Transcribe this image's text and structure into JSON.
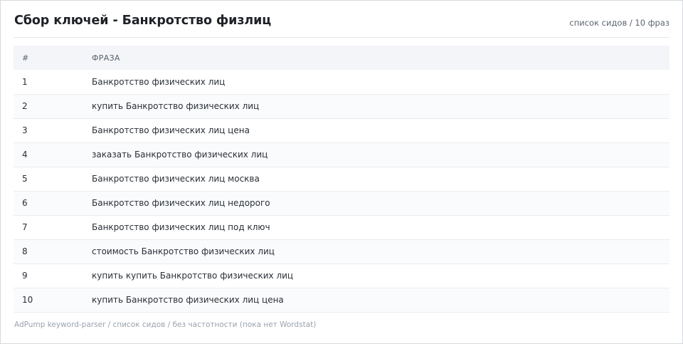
{
  "header": {
    "title": "Сбор ключей - Банкротство физлиц",
    "subtitle": "список сидов / 10 фраз"
  },
  "table": {
    "columns": [
      "#",
      "ФРАЗА"
    ],
    "rows": [
      {
        "num": "1",
        "phrase": "Банкротство физических лиц"
      },
      {
        "num": "2",
        "phrase": "купить Банкротство физических лиц"
      },
      {
        "num": "3",
        "phrase": "Банкротство физических лиц цена"
      },
      {
        "num": "4",
        "phrase": "заказать Банкротство физических лиц"
      },
      {
        "num": "5",
        "phrase": "Банкротство физических лиц москва"
      },
      {
        "num": "6",
        "phrase": "Банкротство физических лиц недорого"
      },
      {
        "num": "7",
        "phrase": "Банкротство физических лиц под ключ"
      },
      {
        "num": "8",
        "phrase": "стоимость Банкротство физических лиц"
      },
      {
        "num": "9",
        "phrase": "купить купить Банкротство физических лиц"
      },
      {
        "num": "10",
        "phrase": "купить Банкротство физических лиц цена"
      }
    ]
  },
  "footer": {
    "text": "AdPump keyword-parser / список сидов / без частотности (пока нет Wordstat)"
  }
}
